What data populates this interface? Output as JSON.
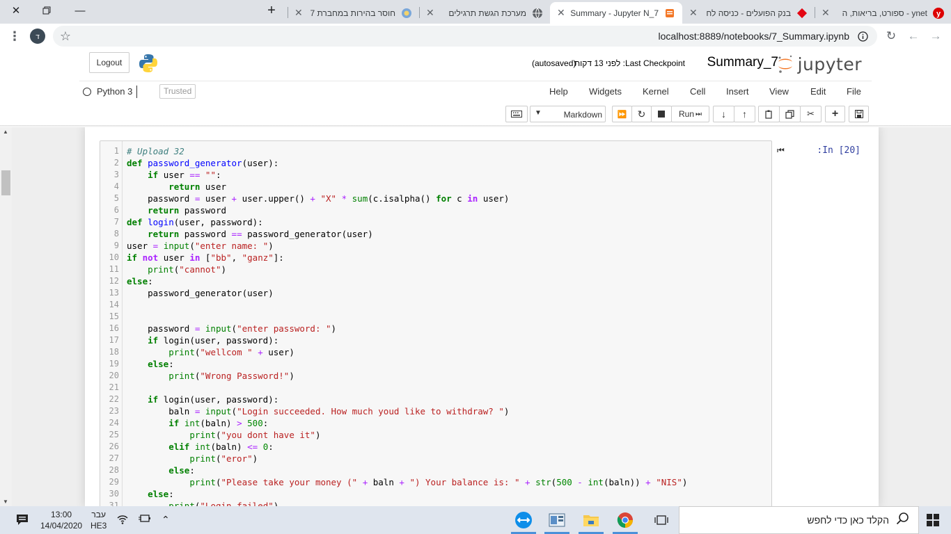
{
  "browser": {
    "tabs": [
      {
        "title": "ynet - ספורט, בריאות, ה",
        "favicon": "ynet-icon"
      },
      {
        "title": "בנק הפועלים - כניסה לח",
        "favicon": "bank-hapoalim-icon"
      },
      {
        "title": "7_Summary - Jupyter N",
        "favicon": "jupyter-notebook-icon"
      },
      {
        "title": "מערכת הגשת תרגילים",
        "favicon": "globe-icon"
      },
      {
        "title": "חוסר בהירות במחברת 7",
        "favicon": "forum-icon"
      }
    ],
    "url": "localhost:8889/notebooks/7_Summary.ipynb",
    "profile_initial": "ד"
  },
  "jupyter": {
    "logout_label": "Logout",
    "logo_text": "jupyter",
    "notebook_name": "Summary_7",
    "checkpoint_text": "Last Checkpoint: לפני 13 דקות",
    "autosaved": "(autosaved)",
    "menus": [
      "File",
      "Edit",
      "View",
      "Insert",
      "Cell",
      "Kernel",
      "Widgets",
      "Help"
    ],
    "trusted_label": "Trusted",
    "kernel_name": "Python 3",
    "run_label": "Run",
    "cell_type": "Markdown",
    "prompt": "In [20]:"
  },
  "code": {
    "lines": [
      "# Upload 32",
      "def password_generator(user):",
      "    if user == \"\":",
      "        return user",
      "    password = user + user.upper() + \"X\" * sum(c.isalpha() for c in user)",
      "    return password",
      "def login(user, password):",
      "    return password == password_generator(user)",
      "user = input(\"enter name: \")",
      "if not user in [\"bb\", \"ganz\"]:",
      "    print(\"cannot\")",
      "else:",
      "    password_generator(user)",
      "",
      "",
      "    password = input(\"enter password: \")",
      "    if login(user, password):",
      "        print(\"wellcom \" + user)",
      "    else:",
      "        print(\"Wrong Password!\")",
      "",
      "    if login(user, password):",
      "        baln = input(\"Login succeeded. How much youd like to withdraw? \")",
      "        if int(baln) > 500:",
      "            print(\"you dont have it\")",
      "        elif int(baln) <= 0:",
      "            print(\"eror\")",
      "        else:",
      "            print(\"Please take your money (\" + baln + \") Your balance is: \" + str(500 - int(baln)) + \"NIS\")",
      "    else:",
      "        print(\"Login failed\")"
    ]
  },
  "taskbar": {
    "search_placeholder": "הקלד כאן כדי לחפש",
    "time": "13:00",
    "date": "14/04/2020",
    "lang_top": "עבר",
    "lang_bottom": "HE3"
  }
}
